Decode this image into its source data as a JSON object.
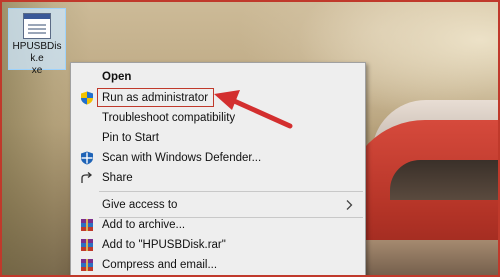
{
  "desktop": {
    "file": {
      "name": "HPUSBDisk.exe",
      "label_lines": [
        "HPUSBDisk.e",
        "xe"
      ]
    }
  },
  "context_menu": {
    "items": [
      {
        "label": "Open",
        "bold": true,
        "icon": ""
      },
      {
        "label": "Run as administrator",
        "icon": "uac-shield-icon",
        "highlighted": true
      },
      {
        "label": "Troubleshoot compatibility",
        "icon": ""
      },
      {
        "label": "Pin to Start",
        "icon": ""
      },
      {
        "label": "Scan with Windows Defender...",
        "icon": "defender-icon"
      },
      {
        "label": "Share",
        "icon": "share-icon"
      },
      {
        "label": "Give access to",
        "icon": "",
        "has_submenu": true
      },
      {
        "label": "Add to archive...",
        "icon": "winrar-icon"
      },
      {
        "label": "Add to \"HPUSBDisk.rar\"",
        "icon": "winrar-icon"
      },
      {
        "label": "Compress and email...",
        "icon": "winrar-icon"
      }
    ]
  },
  "annotation": {
    "color": "#d32f2f"
  }
}
